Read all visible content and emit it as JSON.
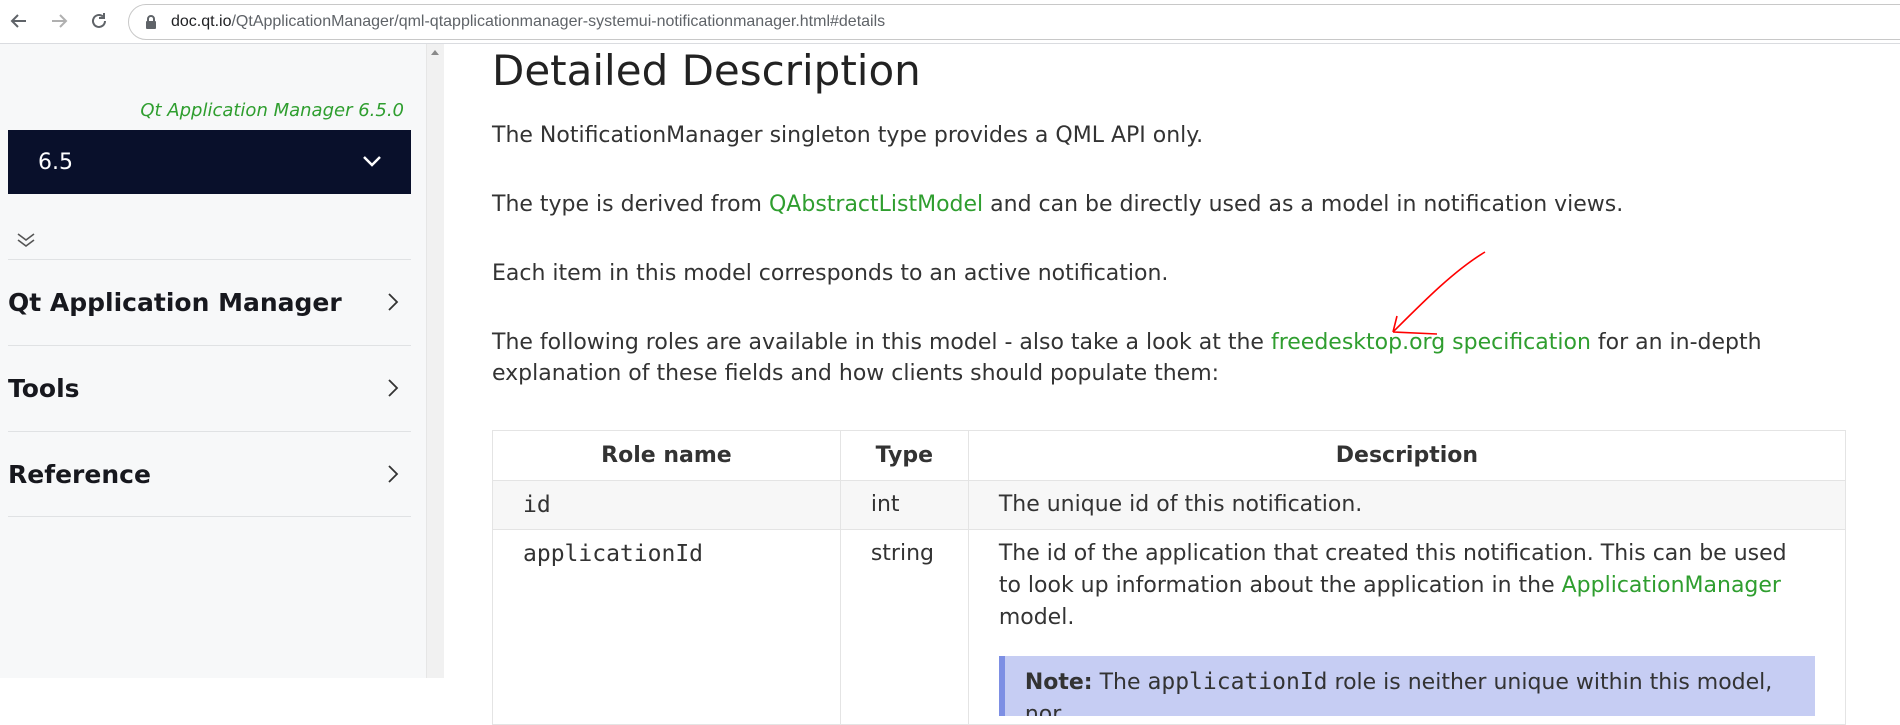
{
  "browser": {
    "url_host": "doc.qt.io",
    "url_path": "/QtApplicationManager/qml-qtapplicationmanager-systemui-notificationmanager.html#details"
  },
  "sidebar": {
    "product_version": "Qt Application Manager 6.5.0",
    "version_selected": "6.5",
    "items": [
      {
        "label": "Qt Application Manager"
      },
      {
        "label": "Tools"
      },
      {
        "label": "Reference"
      }
    ]
  },
  "content": {
    "title": "Detailed Description",
    "p1": "The NotificationManager singleton type provides a QML API only.",
    "p2_before": "The type is derived from ",
    "p2_link": "QAbstractListModel",
    "p2_after": " and can be directly used as a model in notification views.",
    "p3": "Each item in this model corresponds to an active notification.",
    "p4_before": "The following roles are available in this model - also take a look at the ",
    "p4_link": "freedesktop.org specification",
    "p4_after": " for an in-depth explanation of these fields and how clients should populate them:"
  },
  "table": {
    "headers": [
      "Role name",
      "Type",
      "Description"
    ],
    "rows": [
      {
        "role": "id",
        "type": "int",
        "description": "The unique id of this notification."
      },
      {
        "role": "applicationId",
        "type": "string",
        "description_before": "The id of the application that created this notification. This can be used to look up information about the application in the ",
        "description_link": "ApplicationManager",
        "description_after": " model."
      }
    ],
    "note_label": "Note:",
    "note_before": " The ",
    "note_code": "applicationId",
    "note_after": " role is neither unique within this model, nor"
  },
  "colors": {
    "link": "#2f9e2f",
    "version_bg": "#09102b",
    "annotation": "#ff0000"
  },
  "icons": [
    "back-arrow-icon",
    "forward-arrow-icon",
    "reload-icon",
    "lock-icon",
    "chevron-down-icon",
    "double-chevron-down-icon",
    "chevron-right-icon"
  ]
}
